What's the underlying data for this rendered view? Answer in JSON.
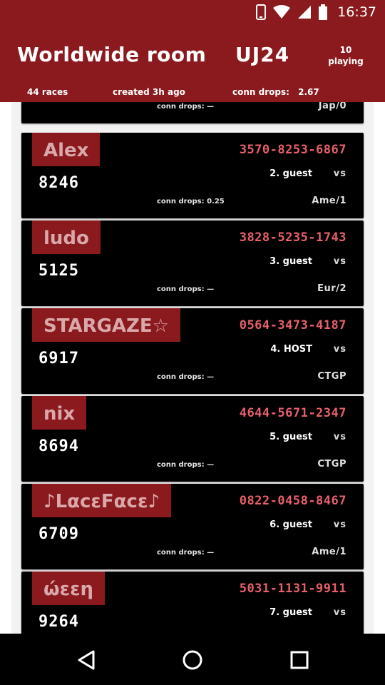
{
  "status_bar": {
    "time": "16:37",
    "icons": [
      "phone-icon",
      "wifi-icon",
      "signal-icon",
      "battery-icon"
    ]
  },
  "header": {
    "title": "Worldwide room",
    "room_code": "UJ24",
    "playing_count": "10",
    "playing_label": "playing",
    "races": "44 races",
    "created": "created 3h ago",
    "conn_drops_label": "conn drops:",
    "conn_drops_value": "2.67"
  },
  "colors": {
    "header_bg": "#8a1a1e",
    "friend_code": "#e8606a",
    "card_bg": "#000000",
    "list_bg": "#f2f2f2"
  },
  "partial_card": {
    "conn": "conn drops: —",
    "region": "Jap/0"
  },
  "players": [
    {
      "name": "Alex",
      "score": "8246",
      "friend_code": "3570-8253-6867",
      "position": "2. guest",
      "vs": "vs",
      "conn": "conn drops: 0.25",
      "region": "Ame/1"
    },
    {
      "name": "ludo",
      "score": "5125",
      "friend_code": "3828-5235-1743",
      "position": "3. guest",
      "vs": "vs",
      "conn": "conn drops: —",
      "region": "Eur/2"
    },
    {
      "name": "STARGAZE☆",
      "score": "6917",
      "friend_code": "0564-3473-4187",
      "position": "4. HOST",
      "vs": "vs",
      "conn": "conn drops: —",
      "region": "CTGP"
    },
    {
      "name": "nix",
      "score": "8694",
      "friend_code": "4644-5671-2347",
      "position": "5. guest",
      "vs": "vs",
      "conn": "conn drops: —",
      "region": "CTGP"
    },
    {
      "name": "♪LαcεFαcε♪",
      "score": "6709",
      "friend_code": "0822-0458-8467",
      "position": "6. guest",
      "vs": "vs",
      "conn": "conn drops: —",
      "region": "Ame/1"
    },
    {
      "name": "ώεεη",
      "score": "9264",
      "friend_code": "5031-1131-9911",
      "position": "7. guest",
      "vs": "vs",
      "conn": "",
      "region": ""
    }
  ],
  "nav": {
    "back": "back-icon",
    "home": "home-icon",
    "recents": "recents-icon"
  }
}
